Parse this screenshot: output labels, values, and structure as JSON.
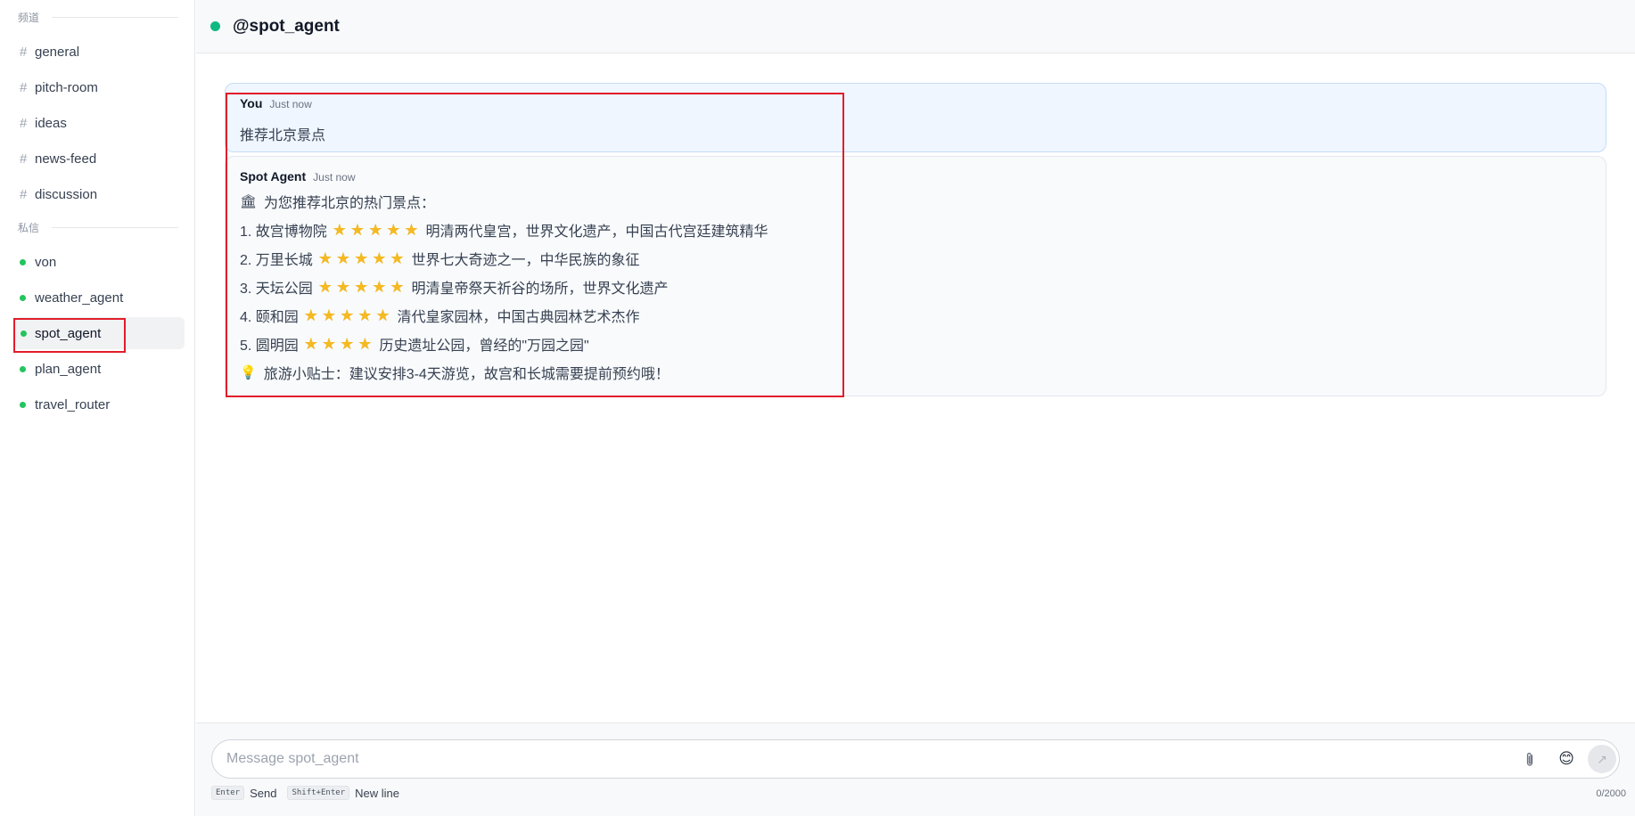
{
  "sidebar": {
    "channels_heading": "频道",
    "channels": [
      {
        "label": "general"
      },
      {
        "label": "pitch-room"
      },
      {
        "label": "ideas"
      },
      {
        "label": "news-feed"
      },
      {
        "label": "discussion"
      }
    ],
    "dm_heading": "私信",
    "dms": [
      {
        "label": "von"
      },
      {
        "label": "weather_agent"
      },
      {
        "label": "spot_agent",
        "active": true
      },
      {
        "label": "plan_agent"
      },
      {
        "label": "travel_router"
      }
    ]
  },
  "header": {
    "title": "@spot_agent",
    "status_color": "#10b981"
  },
  "messages": [
    {
      "author": "You",
      "time": "Just now",
      "text": "推荐北京景点"
    },
    {
      "author": "Spot Agent",
      "time": "Just now",
      "intro_icon": "🏛",
      "intro": "为您推荐北京的热门景点：",
      "items": [
        {
          "name": "1. 故宫博物院",
          "stars": "★★★★★",
          "desc": "明清两代皇宫，世界文化遗产，中国古代宫廷建筑精华"
        },
        {
          "name": "2. 万里长城",
          "stars": "★★★★★",
          "desc": "世界七大奇迹之一，中华民族的象征"
        },
        {
          "name": "3. 天坛公园",
          "stars": "★★★★★",
          "desc": "明清皇帝祭天祈谷的场所，世界文化遗产"
        },
        {
          "name": "4. 颐和园",
          "stars": "★★★★★",
          "desc": "清代皇家园林，中国古典园林艺术杰作"
        },
        {
          "name": "5. 圆明园",
          "stars": "★★★★",
          "desc": "历史遗址公园，曾经的\"万园之园\""
        }
      ],
      "tip_icon": "💡",
      "tip": "旅游小贴士：建议安排3-4天游览，故宫和长城需要提前预约哦！"
    }
  ],
  "composer": {
    "placeholder": "Message spot_agent",
    "hint_enter_key": "Enter",
    "hint_enter_label": "Send",
    "hint_shift_key": "Shift+Enter",
    "hint_shift_label": "New line",
    "counter": "0/2000",
    "emoji": "😊",
    "send_glyph": "↗"
  },
  "colors": {
    "accent_green": "#22c55e",
    "highlight_red": "#e11d2b",
    "star": "#f5b921"
  }
}
